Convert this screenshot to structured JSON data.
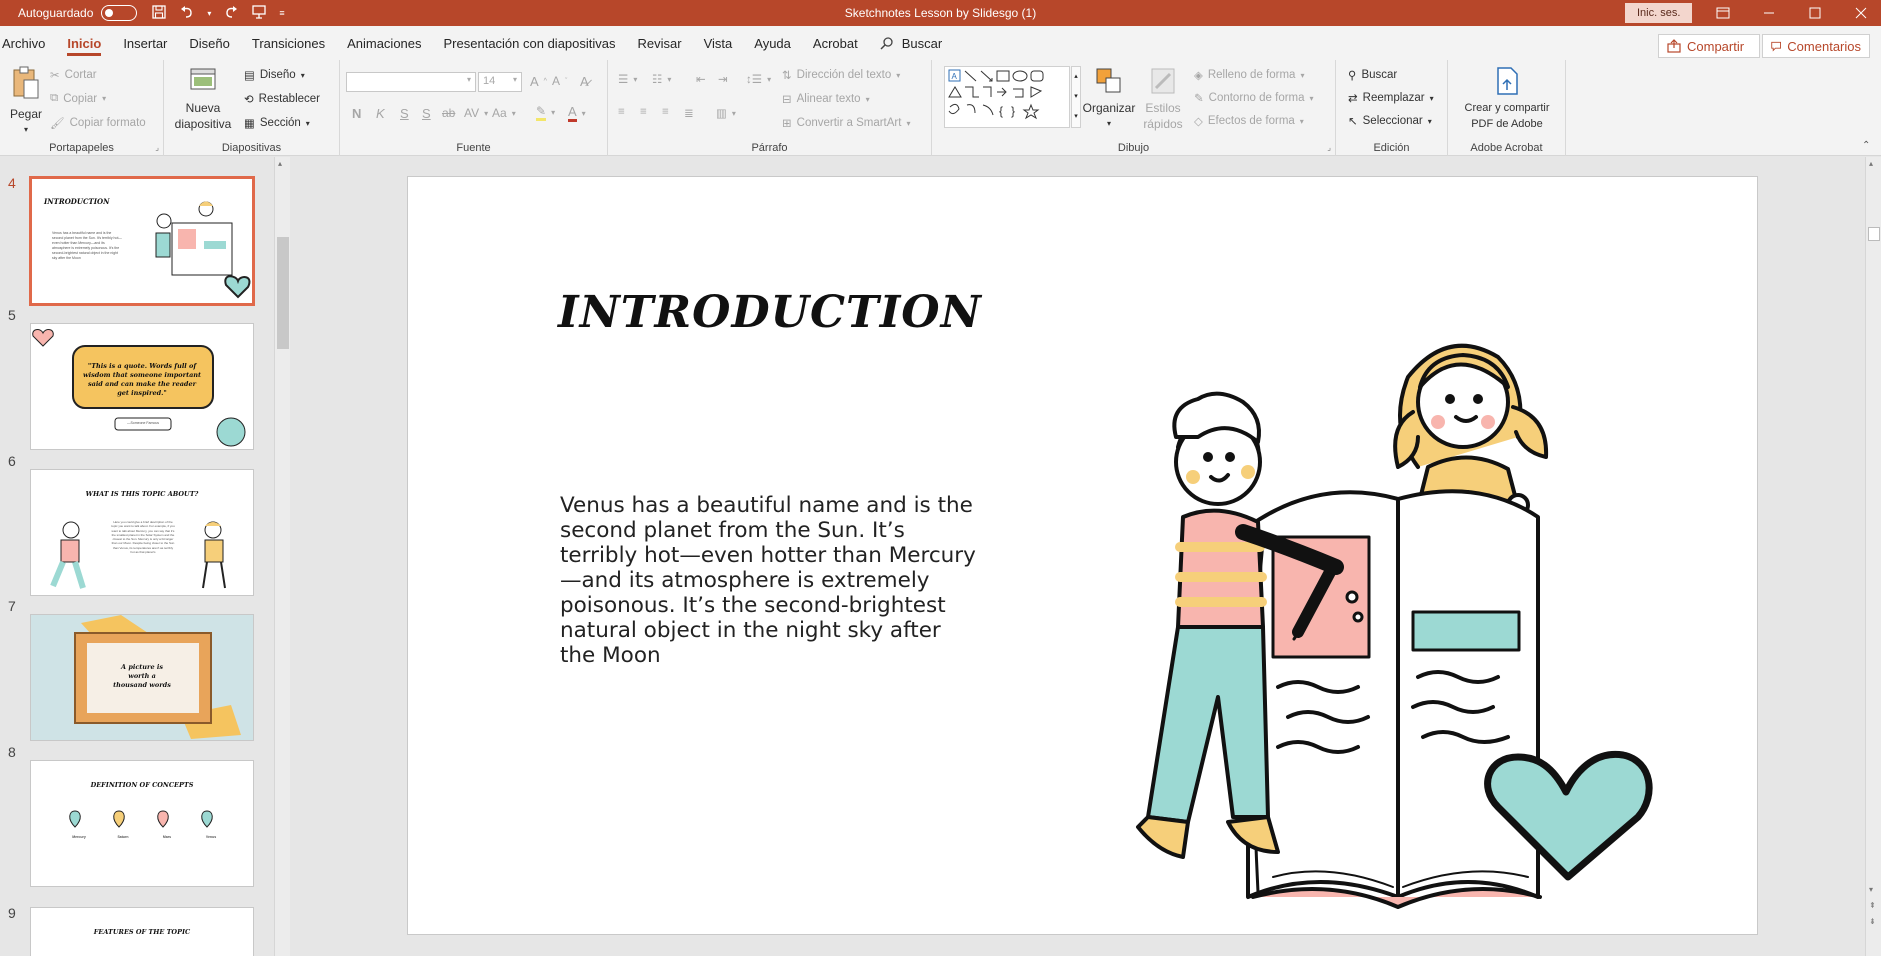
{
  "titlebar": {
    "autosave_label": "Autoguardado",
    "document_title": "Sketchnotes Lesson by Slidesgo (1)",
    "signin_label": "Inic. ses.",
    "accent": "#b7472a"
  },
  "menu": {
    "tabs": [
      "Archivo",
      "Inicio",
      "Insertar",
      "Diseño",
      "Transiciones",
      "Animaciones",
      "Presentación con diapositivas",
      "Revisar",
      "Vista",
      "Ayuda",
      "Acrobat"
    ],
    "search_label": "Buscar",
    "share_label": "Compartir",
    "comments_label": "Comentarios"
  },
  "ribbon": {
    "portapapeles": {
      "label": "Portapapeles",
      "paste": "Pegar",
      "cut": "Cortar",
      "copy": "Copiar",
      "format_painter": "Copiar formato"
    },
    "diapositivas": {
      "label": "Diapositivas",
      "new_slide_1": "Nueva",
      "new_slide_2": "diapositiva",
      "layout": "Diseño",
      "reset": "Restablecer",
      "section": "Sección"
    },
    "fuente": {
      "label": "Fuente",
      "size": "14",
      "bold": "N",
      "italic": "K",
      "underline": "S",
      "strike": "S",
      "strike2": "ab",
      "spacing": "AV",
      "case": "Aa"
    },
    "parrafo": {
      "label": "Párrafo",
      "text_direction": "Dirección del texto",
      "align_text": "Alinear texto",
      "smartart": "Convertir a SmartArt"
    },
    "dibujo": {
      "label": "Dibujo",
      "arrange": "Organizar",
      "quick_styles_1": "Estilos",
      "quick_styles_2": "rápidos",
      "fill": "Relleno de forma",
      "outline": "Contorno de forma",
      "effects": "Efectos de forma"
    },
    "edicion": {
      "label": "Edición",
      "find": "Buscar",
      "replace": "Reemplazar",
      "select": "Seleccionar"
    },
    "acrobat": {
      "label": "Adobe Acrobat",
      "create_1": "Crear y compartir",
      "create_2": "PDF de Adobe"
    }
  },
  "thumbnails": [
    {
      "number": "4",
      "title": "INTRODUCTION",
      "text": "Venus has a beautiful name and is the second planet from the Sun. It's terribly hot—even hotter than Mercury—and its atmosphere is extremely poisonous. It's the second-brightest natural object in the night sky after the Moon"
    },
    {
      "number": "5",
      "title": "\"This is a quote. Words full of wisdom that someone important said and can make the reader get inspired.\"",
      "text": "—Someone Famous"
    },
    {
      "number": "6",
      "title": "WHAT IS THIS TOPIC ABOUT?",
      "text": "Here you could give a brief description of the topic you want to talk about. For example, if you want to talk about Mercury, you can say that it's the smallest planet in the Solar System and the closest to the Sun. Mercury is only a bit larger than our Moon. Despite being closer to the Sun than Venus, its temperatures aren't as terribly hot as that planet's"
    },
    {
      "number": "7",
      "title": "A picture is worth a thousand words",
      "text": ""
    },
    {
      "number": "8",
      "title": "DEFINITION OF CONCEPTS",
      "text": "",
      "concepts": [
        "Mercury",
        "Saturn",
        "Mars",
        "Venus"
      ]
    },
    {
      "number": "9",
      "title": "FEATURES OF THE TOPIC",
      "text": ""
    }
  ],
  "slide": {
    "title": "INTRODUCTION",
    "body": "Venus has a beautiful name and is the second planet from the Sun. It’s terribly hot—even hotter than Mercury—and its atmosphere is extremely poisonous. It’s the second-brightest natural object in the night sky after the Moon",
    "colors": {
      "pink": "#f8b5ae",
      "teal": "#9cd9d3",
      "yellow": "#f6cf7a",
      "orange": "#f5c45f"
    }
  }
}
